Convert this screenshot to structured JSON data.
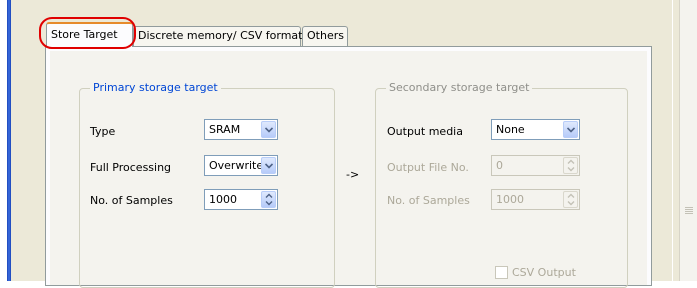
{
  "tabs": [
    {
      "label": "Store Target",
      "active": true
    },
    {
      "label": "Discrete memory/ CSV format",
      "active": false
    },
    {
      "label": "Others",
      "active": false
    }
  ],
  "primary": {
    "title": "Primary storage target",
    "type_label": "Type",
    "type_value": "SRAM",
    "processing_label": "Full Processing",
    "processing_value": "Overwrite",
    "samples_label": "No. of Samples",
    "samples_value": "1000"
  },
  "arrow_label": "->",
  "secondary": {
    "title": "Secondary storage target",
    "media_label": "Output media",
    "media_value": "None",
    "file_no_label": "Output File No.",
    "file_no_value": "0",
    "samples_label": "No. of Samples",
    "samples_value": "1000",
    "csv_label": "CSV Output"
  },
  "colors": {
    "highlight": "#e00000",
    "active_tab_accent": "#e68b2c",
    "group_title": "#0046d5",
    "disabled_text": "#aca899"
  },
  "icons": {
    "dropdown": "chevron-down-icon",
    "spin": "spin-arrows-icon"
  }
}
